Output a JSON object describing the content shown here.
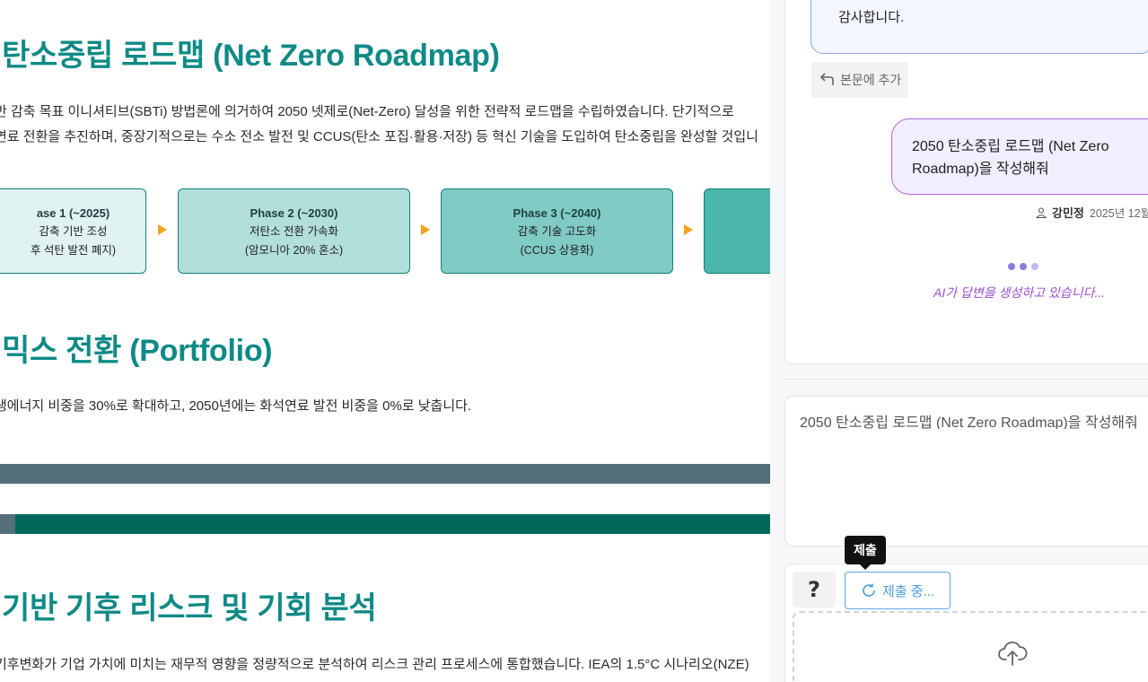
{
  "document": {
    "section1": {
      "title": "탄소중립 로드맵 (Net Zero Roadmap)",
      "line1": "반 감축 목표 이니셔티브(SBTi) 방법론에 의거하여 2050 넷제로(Net-Zero) 달성을 위한 전략적 로드맵을 수립하였습니다. 단기적으로",
      "line2": "연료 전환을 추진하며, 중장기적으로는 수소 전소 발전 및 CCUS(탄소 포집·활용·저장) 등 혁신 기술을 도입하여 탄소중립을 완성할 것입니"
    },
    "phases": [
      {
        "title": "ase 1 (~2025)",
        "line1": "감축 기반 조성",
        "line2": "후 석탄 발전 폐지)",
        "color": "#e0f2f1"
      },
      {
        "title": "Phase 2 (~2030)",
        "line1": "저탄소 전환 가속화",
        "line2": "(암모니아 20% 혼소)",
        "color": "#b2dfdb"
      },
      {
        "title": "Phase 3 (~2040)",
        "line1": "감축 기술 고도화",
        "line2": "(CCUS 상용화)",
        "color": "#80cbc4"
      },
      {
        "title": "",
        "line1": "",
        "line2": "",
        "color": "#4db6ac"
      }
    ],
    "section2": {
      "title": "믹스 전환 (Portfolio)",
      "line1": "생에너지 비중을 30%로 확대하고, 2050년에는 화석연료 발전 비중을 0%로 낮춥니다."
    },
    "bar_colors": {
      "bar1": "#546e7a",
      "bar2_left": "#546e7a",
      "bar2_main": "#00695c"
    },
    "section3": {
      "title": "기반 기후 리스크 및 기회 분석",
      "line1": "기후변화가 기업 가치에 미치는 재무적 영향을 정량적으로 분석하여 리스크 관리 프로세스에 통합했습니다. IEA의 1.5°C 시나리오(NZE)"
    }
  },
  "chat": {
    "ai_message_tail": "감사합니다.",
    "add_to_body_label": "본문에 추가",
    "user_message": "2050 탄소중립 로드맵 (Net Zero Roadmap)을 작성해줘",
    "user_name": "강민정",
    "timestamp": "2025년 12월 2",
    "generating_text": "AI가 답변을 생성하고 있습니다...",
    "prompt_value": "2050 탄소중립 로드맵 (Net Zero Roadmap)을 작성해줘",
    "help_label": "?",
    "submit_label": "제출 중...",
    "tooltip": "제출"
  },
  "icons": {
    "add_to_body": "return-arrow-icon",
    "user": "user-icon",
    "submit": "loading-spinner-icon",
    "upload": "cloud-upload-icon"
  },
  "colors": {
    "heading": "#0f8a86",
    "arrow": "#f5a21b",
    "ai_bubble_border": "#8aa8e8",
    "user_bubble_border": "#b264d8",
    "generating": "#9b4fcf",
    "submit": "#4a9bdc"
  }
}
